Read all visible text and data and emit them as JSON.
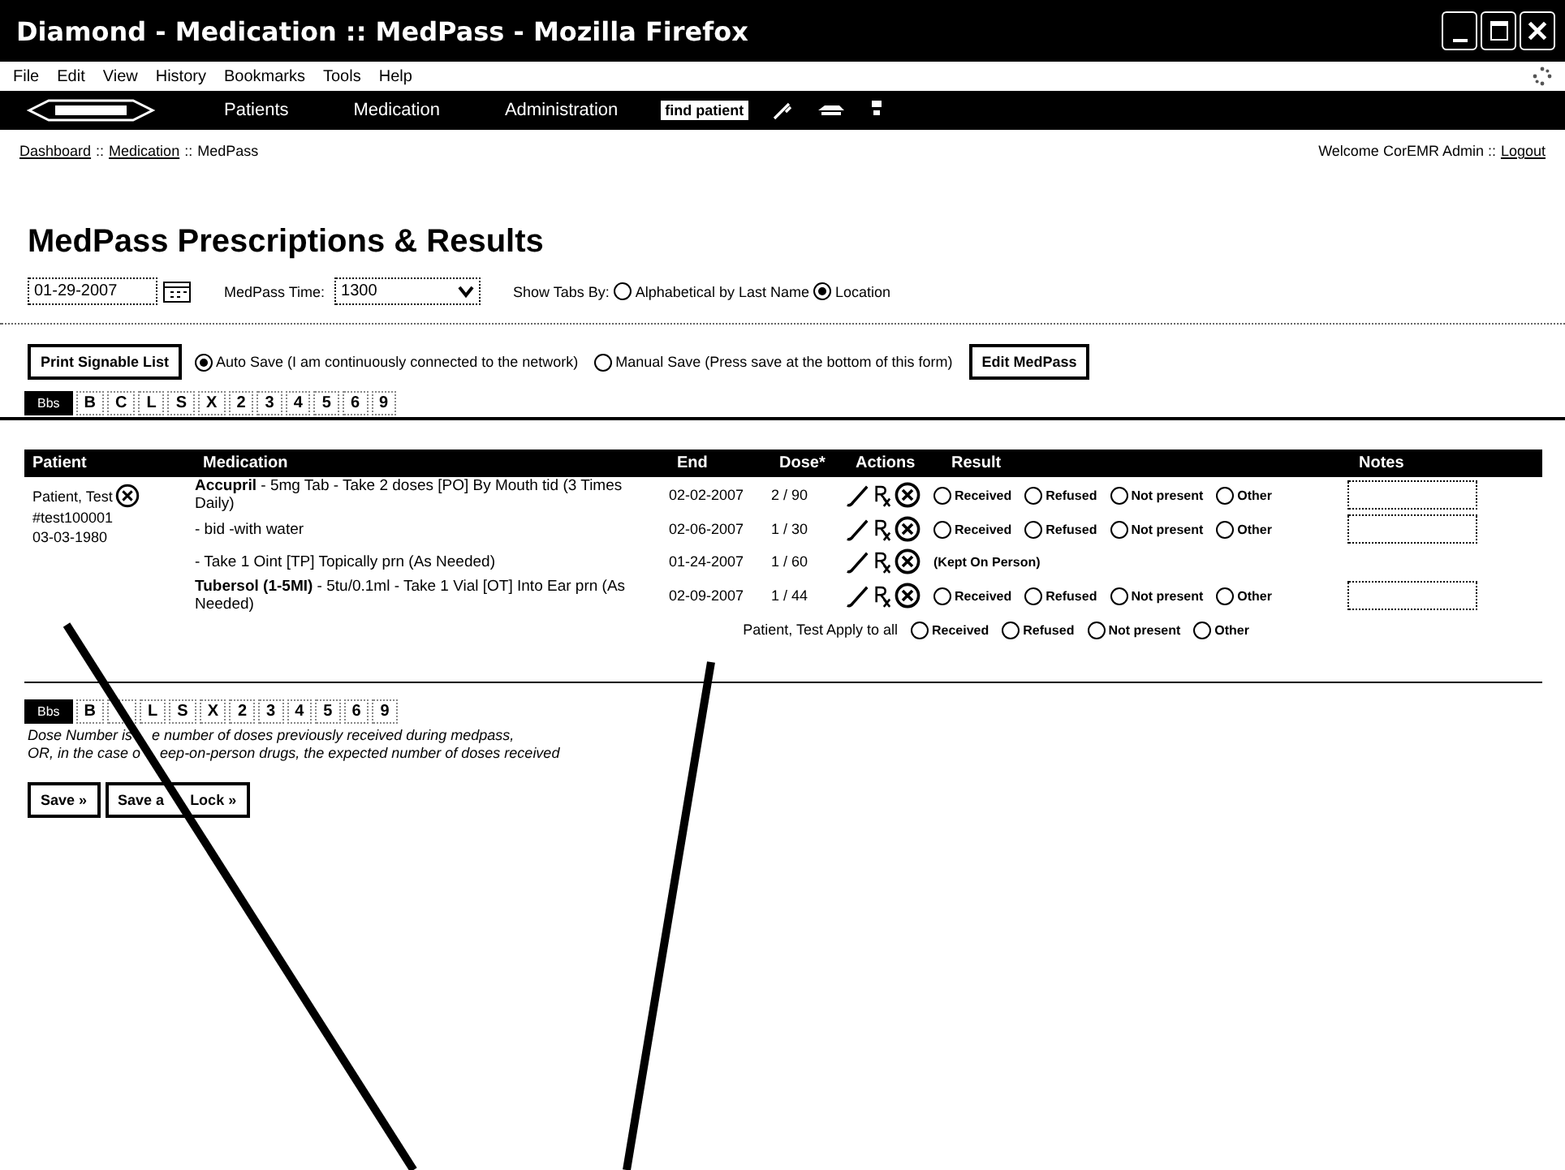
{
  "window": {
    "title": "Diamond - Medication :: MedPass - Mozilla Firefox"
  },
  "menu": [
    "File",
    "Edit",
    "View",
    "History",
    "Bookmarks",
    "Tools",
    "Help"
  ],
  "nav": {
    "items": [
      "Patients",
      "Medication",
      "Administration"
    ],
    "search_button": "find patient"
  },
  "breadcrumb": {
    "items": [
      "Dashboard",
      "Medication",
      "MedPass"
    ],
    "separator": "::"
  },
  "welcome": {
    "text": "Welcome CorEMR Admin ::",
    "link": "Logout"
  },
  "heading": "MedPass Prescriptions & Results",
  "filters": {
    "date": "01-29-2007",
    "time_label": "MedPass Time:",
    "time": "1300",
    "tabs_label": "Show Tabs By:",
    "options": [
      {
        "label": "Alphabetical by Last Name",
        "selected": false
      },
      {
        "label": "Location",
        "selected": true
      }
    ]
  },
  "save_row": {
    "print_button": "Print Signable List",
    "modes": [
      {
        "label": "Auto Save (I am continuously connected to the network)",
        "selected": true
      },
      {
        "label": "Manual Save (Press save at the bottom of this form)",
        "selected": false
      }
    ],
    "edit_button": "Edit MedPass"
  },
  "tabs_top": [
    {
      "label": "Bbs",
      "selected": true
    },
    {
      "label": "B",
      "selected": false
    },
    {
      "label": "C",
      "selected": false
    },
    {
      "label": "L",
      "selected": false
    },
    {
      "label": "S",
      "selected": false
    },
    {
      "label": "X",
      "selected": false
    },
    {
      "label": "2",
      "selected": false
    },
    {
      "label": "3",
      "selected": false
    },
    {
      "label": "4",
      "selected": false
    },
    {
      "label": "5",
      "selected": false
    },
    {
      "label": "6",
      "selected": false
    },
    {
      "label": "9",
      "selected": false
    }
  ],
  "table": {
    "columns": [
      "Patient",
      "Medication",
      "End",
      "Dose*",
      "Actions",
      "Result",
      "Notes"
    ],
    "patient": {
      "name": "Patient, Test",
      "id": "#test100001",
      "dob": "03-03-1980"
    },
    "rows": [
      {
        "kind": "options",
        "medication": "**Accupril** - 5mg Tab - Take 2 doses [PO] By Mouth tid (3 Times Daily)",
        "end": "02-02-2007",
        "dose": "2 / 90",
        "results": [
          {
            "label": "Received",
            "selected": false
          },
          {
            "label": "Refused",
            "selected": false
          },
          {
            "label": "Not present",
            "selected": false
          },
          {
            "label": "Other",
            "selected": false
          }
        ],
        "notes": true
      },
      {
        "kind": "options",
        "medication": "- bid -with water",
        "end": "02-06-2007",
        "dose": "1 / 30",
        "results": [
          {
            "label": "Received",
            "selected": false
          },
          {
            "label": "Refused",
            "selected": false
          },
          {
            "label": "Not present",
            "selected": false
          },
          {
            "label": "Other",
            "selected": false
          }
        ],
        "notes": true
      },
      {
        "kind": "kept",
        "medication": "- Take 1 Oint [TP] Topically prn (As Needed)",
        "end": "01-24-2007",
        "dose": "1 / 60",
        "result_text": "(Kept On Person)",
        "notes": false
      },
      {
        "kind": "options",
        "medication": "**Tubersol (1-5MI)** - 5tu/0.1ml - Take 1 Vial [OT] Into Ear prn (As Needed)",
        "end": "02-09-2007",
        "dose": "1 / 44",
        "results": [
          {
            "label": "Received",
            "selected": false
          },
          {
            "label": "Refused",
            "selected": false
          },
          {
            "label": "Not present",
            "selected": false
          },
          {
            "label": "Other",
            "selected": false
          }
        ],
        "notes": true
      }
    ],
    "apply": {
      "label": "Patient, Test Apply to all",
      "results": [
        {
          "label": "Received",
          "selected": false
        },
        {
          "label": "Refused",
          "selected": false
        },
        {
          "label": "Not present",
          "selected": false
        },
        {
          "label": "Other",
          "selected": false
        }
      ]
    }
  },
  "tabs_bottom": [
    {
      "label": "Bbs",
      "selected": true
    },
    {
      "label": "B",
      "selected": false
    },
    {
      "selected": false
    },
    {
      "label": "L",
      "selected": false
    },
    {
      "label": "S",
      "selected": false
    },
    {
      "label": "X",
      "selected": false
    },
    {
      "label": "2",
      "selected": false
    },
    {
      "label": "3",
      "selected": false
    },
    {
      "label": "4",
      "selected": false
    },
    {
      "label": "5",
      "selected": false
    },
    {
      "label": "6",
      "selected": false
    },
    {
      "label": "9",
      "selected": false
    }
  ],
  "notes": [
    [
      "Dose Number is",
      "e number of doses previously received during medpass,"
    ],
    [
      "OR, in the case o",
      "eep-on-person drugs, the expected number of doses received"
    ]
  ],
  "buttons": [
    [
      "Save »"
    ],
    [
      "Save a",
      "Lock »"
    ]
  ]
}
